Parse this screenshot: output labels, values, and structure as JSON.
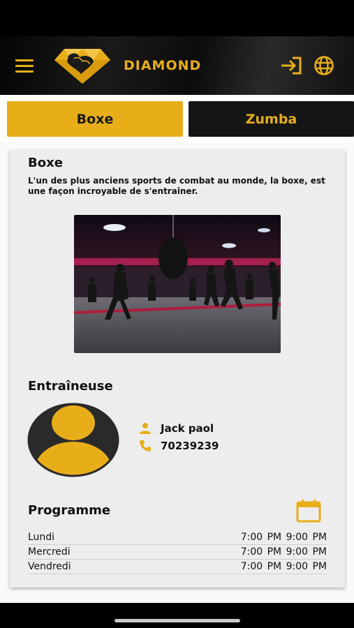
{
  "header": {
    "brand": "DIAMOND",
    "menu_icon": "hamburger-menu-icon",
    "login_icon": "login-icon",
    "language_icon": "globe-icon",
    "accent_color": "#e8ae1a"
  },
  "tabs": [
    {
      "label": "Boxe",
      "active": true
    },
    {
      "label": "Zumba",
      "active": false
    }
  ],
  "sport": {
    "title": "Boxe",
    "description": "L'un des plus anciens sports de combat au monde, la boxe, est une façon incroyable de s'entraîner."
  },
  "coach": {
    "section_title": "Entraîneuse",
    "name": "Jack paol",
    "phone": "70239239"
  },
  "program": {
    "section_title": "Programme",
    "schedule": [
      {
        "day": "Lundi",
        "start": "7:00 PM",
        "end": "9:00 PM"
      },
      {
        "day": "Mercredi",
        "start": "7:00 PM",
        "end": "9:00 PM"
      },
      {
        "day": "Vendredi",
        "start": "7:00 PM",
        "end": "9:00 PM"
      }
    ]
  }
}
